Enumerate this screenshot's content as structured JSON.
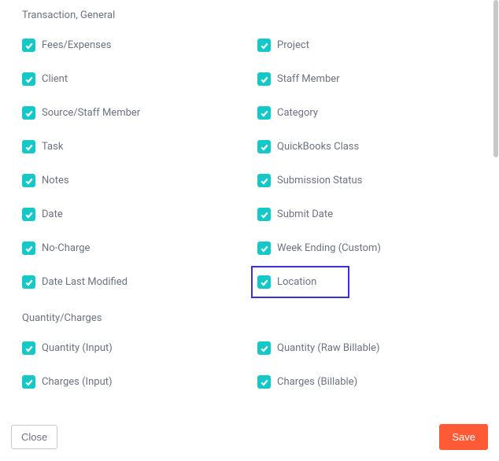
{
  "sections": {
    "transaction": {
      "title": "Transaction, General",
      "items": [
        {
          "label": "Fees/Expenses",
          "name": "fees-expenses"
        },
        {
          "label": "Project",
          "name": "project"
        },
        {
          "label": "Client",
          "name": "client"
        },
        {
          "label": "Staff Member",
          "name": "staff-member"
        },
        {
          "label": "Source/Staff Member",
          "name": "source-staff-member"
        },
        {
          "label": "Category",
          "name": "category"
        },
        {
          "label": "Task",
          "name": "task"
        },
        {
          "label": "QuickBooks Class",
          "name": "quickbooks-class"
        },
        {
          "label": "Notes",
          "name": "notes"
        },
        {
          "label": "Submission Status",
          "name": "submission-status"
        },
        {
          "label": "Date",
          "name": "date"
        },
        {
          "label": "Submit Date",
          "name": "submit-date"
        },
        {
          "label": "No-Charge",
          "name": "no-charge"
        },
        {
          "label": "Week Ending (Custom)",
          "name": "week-ending-custom"
        },
        {
          "label": "Date Last Modified",
          "name": "date-last-modified"
        },
        {
          "label": "Location",
          "name": "location",
          "highlighted": true
        }
      ]
    },
    "quantity": {
      "title": "Quantity/Charges",
      "items": [
        {
          "label": "Quantity (Input)",
          "name": "quantity-input"
        },
        {
          "label": "Quantity (Raw Billable)",
          "name": "quantity-raw-billable"
        },
        {
          "label": "Charges (Input)",
          "name": "charges-input"
        },
        {
          "label": "Charges (Billable)",
          "name": "charges-billable"
        }
      ]
    }
  },
  "footer": {
    "close_label": "Close",
    "save_label": "Save"
  }
}
